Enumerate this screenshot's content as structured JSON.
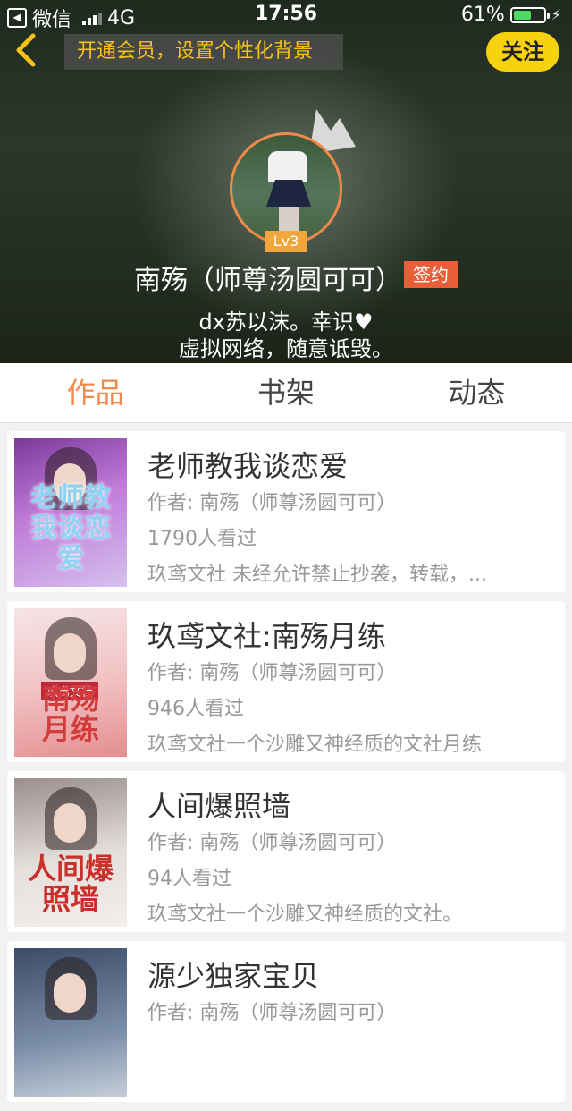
{
  "status_bar": {
    "carrier": "微信",
    "network": "4G",
    "time": "17:56",
    "battery": "61%",
    "battery_level": 0.61,
    "back_app_icon": "back-to-app-icon"
  },
  "header": {
    "vip_banner": "开通会员，设置个性化背景",
    "follow_label": "关注",
    "level": "Lv3",
    "username": "南殇（师尊汤圆可可）",
    "signed_label": "签约",
    "bio_line1": "dx苏以沫。幸识♥",
    "bio_line2": "虚拟网络，随意诋毁。",
    "accent_color": "#f8d20f"
  },
  "tabs": [
    {
      "label": "作品",
      "active": true
    },
    {
      "label": "书架",
      "active": false
    },
    {
      "label": "动态",
      "active": false
    }
  ],
  "works": [
    {
      "title": "老师教我谈恋爱",
      "author": "作者: 南殇（师尊汤圆可可）",
      "views": "1790人看过",
      "description": "玖鸢文社   未经允许禁止抄袭，转载，...",
      "cover_text": "老师教我谈恋爱"
    },
    {
      "title": "玖鸢文社:南殇月练",
      "author": "作者: 南殇（师尊汤圆可可）",
      "views": "946人看过",
      "description": "玖鸢文社一个沙雕又神经质的文社月练",
      "cover_tag": "玖鸢文社",
      "cover_text": "南殇月练"
    },
    {
      "title": "人间爆照墙",
      "author": "作者: 南殇（师尊汤圆可可）",
      "views": "94人看过",
      "description": "玖鸢文社一个沙雕又神经质的文社。",
      "cover_text": "人间爆照墙"
    },
    {
      "title": "源少独家宝贝",
      "author": "作者: 南殇（师尊汤圆可可）",
      "views": "",
      "description": "",
      "cover_text": ""
    }
  ]
}
